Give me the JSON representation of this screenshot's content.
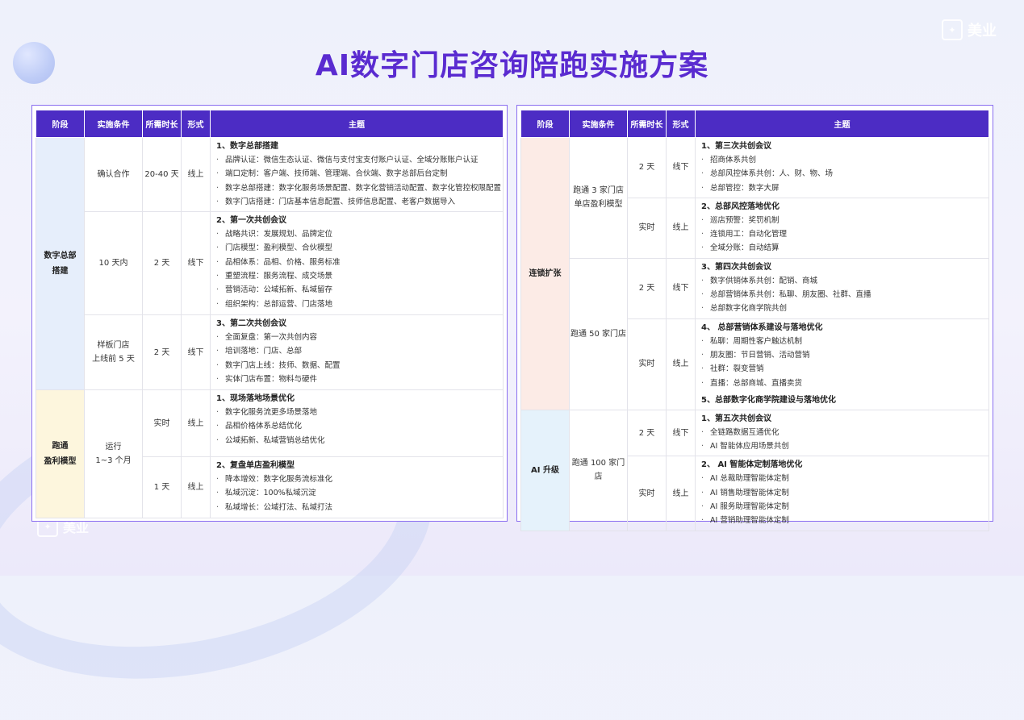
{
  "title": "AI数字门店咨询陪跑实施方案",
  "brand": "美业",
  "headers": [
    "阶段",
    "实施条件",
    "所需时长",
    "形式",
    "主题"
  ],
  "left": {
    "phase1": "数字总部搭建",
    "phase1_lines": [
      "数字总部",
      "搭建"
    ],
    "phase2_lines": [
      "跑通",
      "盈利模型"
    ],
    "rows": [
      {
        "cond": "确认合作",
        "dur": "20-40 天",
        "form": "线上",
        "blocks": [
          {
            "head": "1、数字总部搭建",
            "items": [
              "品牌认证：微信生态认证、微信与支付宝支付账户认证、全域分账账户认证",
              "端口定制：客户端、技师端、管理端、合伙端、数字总部后台定制",
              "数字总部搭建：数字化服务场景配置、数字化营销活动配置、数字化管控权限配置",
              "数字门店搭建：门店基本信息配置、技师信息配置、老客户数据导入"
            ]
          }
        ]
      },
      {
        "cond": "10 天内",
        "dur": "2 天",
        "form": "线下",
        "blocks": [
          {
            "head": "2、第一次共创会议",
            "items": [
              "战略共识：发展规划、品牌定位",
              "门店模型：盈利模型、合伙模型",
              "品相体系：品相、价格、服务标准",
              "重塑流程：服务流程、成交场景",
              "营销活动：公域拓新、私域留存",
              "组织架构：总部运营、门店落地"
            ]
          }
        ]
      },
      {
        "cond_lines": [
          "样板门店",
          "上线前 5 天"
        ],
        "dur": "2 天",
        "form": "线下",
        "blocks": [
          {
            "head": "3、第二次共创会议",
            "items": [
              "全面复盘：第一次共创内容",
              "培训落地：门店、总部",
              "数字门店上线：技师、数据、配置",
              "实体门店布置：物料与硬件"
            ]
          }
        ]
      },
      {
        "cond_lines": [
          "运行",
          "1~3 个月"
        ],
        "dur": "实时",
        "form": "线上",
        "blocks": [
          {
            "head": "1、现场落地场景优化",
            "items": [
              "数字化服务流更多场景落地",
              "品相价格体系总结优化",
              "公域拓新、私域营销总结优化"
            ]
          }
        ]
      },
      {
        "dur": "1 天",
        "form": "线上",
        "blocks": [
          {
            "head": "2、复盘单店盈利模型",
            "items": [
              "降本增效：数字化服务流标准化",
              "私域沉淀：100%私域沉淀",
              "私域增长：公域打法、私域打法"
            ]
          }
        ]
      }
    ]
  },
  "right": {
    "phase1": "连锁扩张",
    "phase2": "AI 升级",
    "cond_a_lines": [
      "跑通 3 家门店",
      "单店盈利模型"
    ],
    "cond_b": "跑通 50 家门店",
    "cond_c": "跑通 100 家门店",
    "rows": [
      {
        "dur": "2 天",
        "form": "线下",
        "blocks": [
          {
            "head": "1、第三次共创会议",
            "items": [
              "招商体系共创",
              "总部风控体系共创：人、财、物、场",
              "总部管控：数字大屏"
            ]
          }
        ]
      },
      {
        "dur": "实时",
        "form": "线上",
        "blocks": [
          {
            "head": "2、总部风控落地优化",
            "items": [
              "巡店预警：奖罚机制",
              "连锁用工：自动化管理",
              "全域分账：自动结算"
            ]
          }
        ]
      },
      {
        "dur": "2 天",
        "form": "线下",
        "blocks": [
          {
            "head": "3、第四次共创会议",
            "items": [
              "数字供销体系共创：配销、商城",
              "总部营销体系共创：私聊、朋友圈、社群、直播",
              "总部数字化商学院共创"
            ]
          }
        ]
      },
      {
        "dur": "实时",
        "form": "线上",
        "blocks": [
          {
            "head": "4、 总部营销体系建设与落地优化",
            "items": [
              "私聊：周期性客户触达机制",
              "朋友圈：节日营销、活动营销",
              "社群：裂变营销",
              "直播：总部商城、直播卖货"
            ]
          },
          {
            "head": "5、总部数字化商学院建设与落地优化",
            "items": []
          }
        ]
      },
      {
        "dur": "2 天",
        "form": "线下",
        "blocks": [
          {
            "head": "1、第五次共创会议",
            "items": [
              "全链路数据互通优化",
              "AI 智能体应用场景共创"
            ]
          }
        ]
      },
      {
        "dur": "实时",
        "form": "线上",
        "blocks": [
          {
            "head": "2、 AI 智能体定制落地优化",
            "items": [
              "AI 总裁助理智能体定制",
              "AI 销售助理智能体定制",
              "AI 服务助理智能体定制",
              "AI 营销助理智能体定制"
            ]
          }
        ]
      }
    ]
  }
}
